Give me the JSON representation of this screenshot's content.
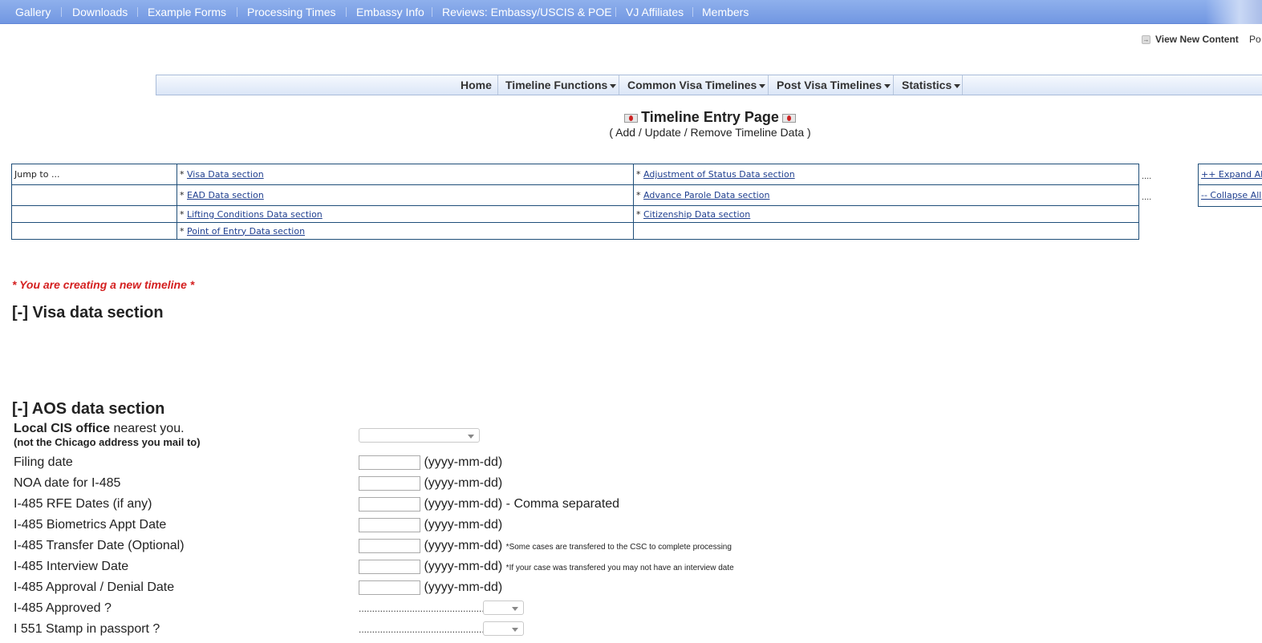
{
  "topnav": {
    "items": [
      "Gallery",
      "Downloads",
      "Example Forms",
      "Processing Times",
      "Embassy Info",
      "Reviews: Embassy/USCIS & POE",
      "VJ Affiliates",
      "Members"
    ]
  },
  "utility": {
    "view_new_content": "View New Content",
    "partial_next": "Po"
  },
  "menu": {
    "items": [
      "Home",
      "Timeline Functions",
      "Common Visa Timelines",
      "Post Visa Timelines",
      "Statistics"
    ]
  },
  "page": {
    "title": "Timeline Entry Page",
    "subtitle": "( Add / Update / Remove Timeline Data )"
  },
  "jump": {
    "label": "Jump to ...",
    "bullet": "*",
    "links": [
      "Visa Data section",
      "Adjustment of Status Data section",
      "EAD Data section",
      "Advance Parole Data section",
      "Lifting Conditions Data section",
      "Citizenship Data section",
      "Point of Entry Data section"
    ],
    "dots": "....",
    "expand_all": "++ Expand All",
    "collapse_all": "-- Collapse All"
  },
  "notice": "* You are creating a new timeline *",
  "sections": {
    "visa": "[-] Visa data section",
    "aos": "[-] AOS data section"
  },
  "form": {
    "cis_office_label_bold": "Local CIS office",
    "cis_office_label_rest": " nearest you.",
    "cis_office_sub": "(not the Chicago address you mail to)",
    "date_hint": "(yyyy-mm-dd)",
    "filing_date": "Filing date",
    "noa_date": "NOA date for I-485",
    "rfe_dates": "I-485 RFE Dates (if any)",
    "rfe_hint": "(yyyy-mm-dd) - Comma separated",
    "biometrics": "I-485 Biometrics Appt Date",
    "transfer": "I-485 Transfer Date (Optional)",
    "transfer_note": "*Some cases are transfered to the CSC to complete processing",
    "interview": "I-485 Interview Date",
    "interview_note": "*If your case was transfered you may not have an interview date",
    "approval": "I-485 Approval / Denial Date",
    "approved": "I-485 Approved ?",
    "stamp": "I 551 Stamp in passport ?",
    "dot_leader": "................................................"
  }
}
